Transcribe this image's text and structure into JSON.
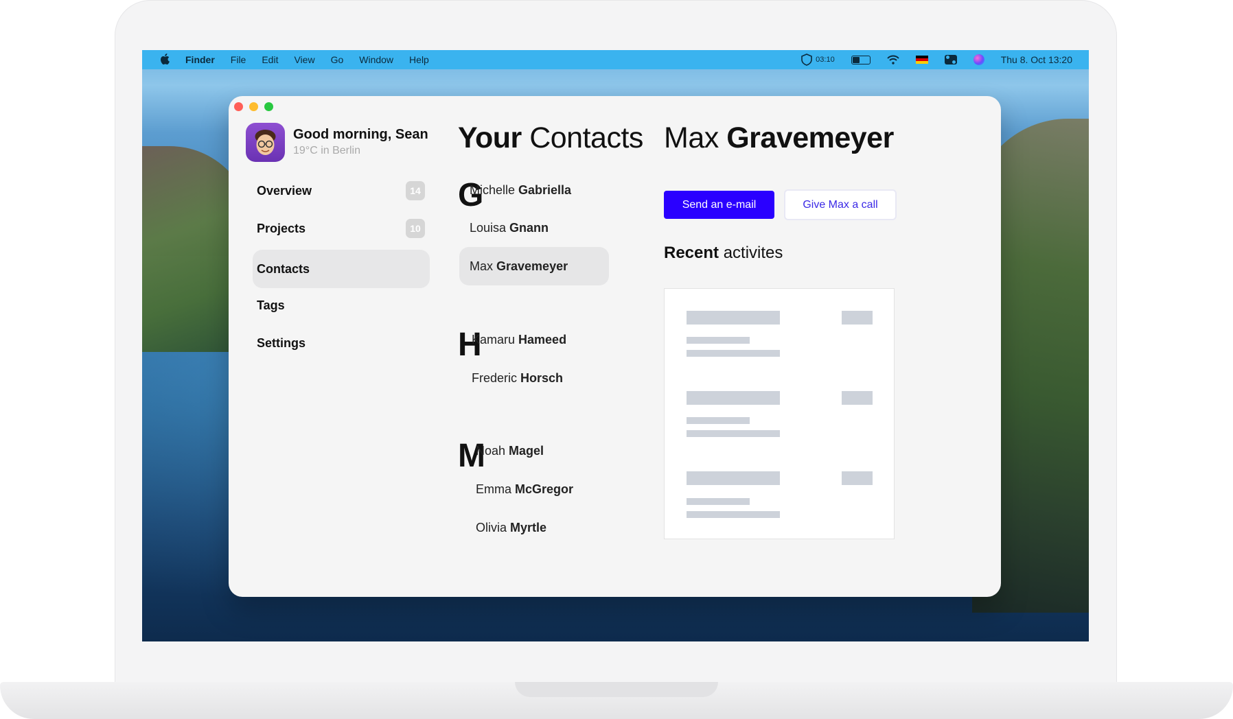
{
  "menubar": {
    "app_name": "Finder",
    "menus": [
      "File",
      "Edit",
      "View",
      "Go",
      "Window",
      "Help"
    ],
    "vpn_time": "03:10",
    "battery_level": 0.45,
    "datetime": "Thu 8. Oct  13:20"
  },
  "sidebar": {
    "greeting": "Good morning, Sean",
    "weather": "19°C in Berlin",
    "items": [
      {
        "label": "Overview",
        "badge": "14"
      },
      {
        "label": "Projects",
        "badge": "10"
      },
      {
        "label": "Contacts",
        "active": true
      },
      {
        "label": "Tags"
      },
      {
        "label": "Settings"
      }
    ]
  },
  "contacts": {
    "heading_bold": "Your",
    "heading_rest": "Contacts",
    "groups": [
      {
        "letter": "G",
        "people": [
          {
            "first": "Michelle",
            "last": "Gabriella"
          },
          {
            "first": "Louisa",
            "last": "Gnann"
          },
          {
            "first": "Max",
            "last": "Gravemeyer",
            "active": true
          }
        ]
      },
      {
        "letter": "H",
        "people": [
          {
            "first": "Kamaru",
            "last": "Hameed"
          },
          {
            "first": "Frederic",
            "last": "Horsch"
          }
        ]
      },
      {
        "letter": "M",
        "people": [
          {
            "first": "Noah",
            "last": "Magel"
          },
          {
            "first": "Emma",
            "last": "McGregor"
          },
          {
            "first": "Olivia",
            "last": "Myrtle"
          }
        ]
      }
    ]
  },
  "detail": {
    "first_name": "Max",
    "last_name": "Gravemeyer",
    "email_button": "Send an e-mail",
    "call_button": "Give Max a call",
    "recent_bold": "Recent",
    "recent_rest": "activites"
  },
  "colors": {
    "primary": "#2a00ff",
    "menubar": "#3ab3ef"
  }
}
